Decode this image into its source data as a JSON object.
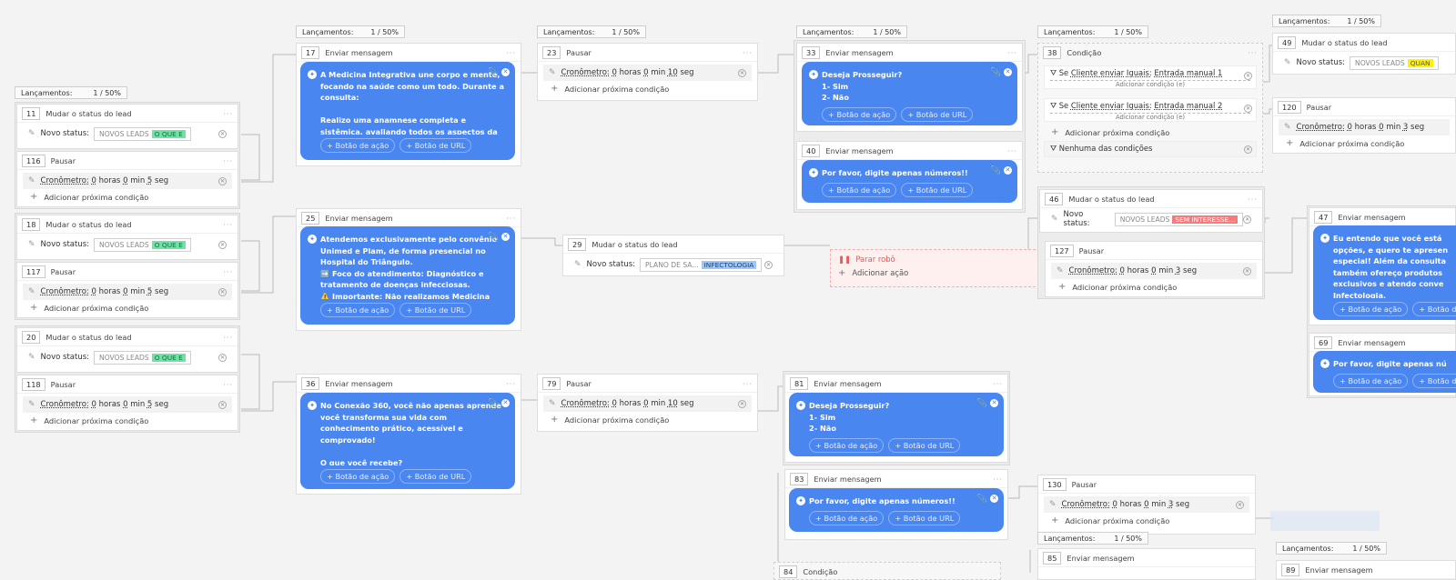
{
  "groups": {
    "g1": {
      "lancamentos": "Lançamentos:",
      "count": "1 / 50%"
    },
    "g2": {
      "lancamentos": "Lançamentos:",
      "count": "1 / 50%"
    },
    "g3": {
      "lancamentos": "Lançamentos:",
      "count": "1 / 50%"
    },
    "g4": {
      "lancamentos": "Lançamentos:",
      "count": "1 / 50%"
    },
    "g5": {
      "lancamentos": "Lançamentos:",
      "count": "1 / 50%"
    },
    "g6": {
      "lancamentos": "Lançamentos:",
      "count": "1 / 50%"
    },
    "g7": {
      "lancamentos": "Lançamentos:",
      "count": "1 / 50%"
    },
    "g8": {
      "lancamentos": "Lançamentos:",
      "count": "1 / 50%"
    }
  },
  "labels": {
    "mudar": "Mudar o status do lead",
    "pausar": "Pausar",
    "enviar": "Enviar mensagem",
    "condicao": "Condição",
    "novo_status": "Novo status:",
    "cron": "Cronômetro:",
    "horas": "horas",
    "min": "min",
    "seg": "seg",
    "add_cond": "Adicionar próxima condição",
    "add_acao": "Adicionar ação",
    "btn_acao": "+ Botão de ação",
    "btn_url": "+ Botão de URL",
    "parar": "Parar robô",
    "nenhuma": "Nenhuma das condições",
    "adicionar_condicao_e": "Adicionar condição (e)",
    "se": "Se",
    "cliente_enviar": "Cliente enviar",
    "iguais": "Iguais:",
    "novos_leads": "NOVOS LEADS",
    "plano": "PLANO DE SA..."
  },
  "nodes": {
    "n11": {
      "id": "11",
      "tag": "O QUE E"
    },
    "n116": {
      "id": "116",
      "h": "0",
      "m": "0",
      "s": "5"
    },
    "n18": {
      "id": "18",
      "tag": "O QUE E"
    },
    "n117": {
      "id": "117",
      "h": "0",
      "m": "0",
      "s": "5"
    },
    "n20": {
      "id": "20",
      "tag": "O QUE E"
    },
    "n118": {
      "id": "118",
      "h": "0",
      "m": "0",
      "s": "5"
    },
    "n17": {
      "id": "17",
      "msg": "A Medicina Integrativa une corpo e mente, focando na saúde como um todo. Durante a consulta:\n\nRealizo uma anamnese completa e sistêmica, avaliando todos os aspectos da"
    },
    "n25": {
      "id": "25",
      "msg": "Atendemos exclusivamente pelo convênio Unimed e Plam, de forma presencial no Hospital do Triângulo.\n➡️ Foco do atendimento: Diagnóstico e tratamento de doenças infecciosas.\n⚠️ Importante: Não realizamos Medicina"
    },
    "n36": {
      "id": "36",
      "msg": "No Conexão 360, você não apenas aprende – você transforma sua vida com conhecimento prático, acessível e comprovado!\n\nO que você recebe?"
    },
    "n23": {
      "id": "23",
      "h": "0",
      "m": "0",
      "s": "10"
    },
    "n29": {
      "id": "29",
      "tag": "INFECTOLOGIA"
    },
    "n79": {
      "id": "79",
      "h": "0",
      "m": "0",
      "s": "10"
    },
    "n33": {
      "id": "33",
      "msg": "Deseja Prosseguir?\n1- Sim\n2- Não"
    },
    "n40": {
      "id": "40",
      "msg": "Por favor, digite apenas números!!"
    },
    "n81": {
      "id": "81",
      "msg": "Deseja Prosseguir?\n1- Sim\n2- Não"
    },
    "n83": {
      "id": "83",
      "msg": "Por favor, digite apenas números!!"
    },
    "n84": {
      "id": "84"
    },
    "n38": {
      "id": "38",
      "c1": "Entrada manual 1",
      "c2": "Entrada manual 2"
    },
    "n46": {
      "id": "46",
      "tag": "SEM INTERESSE..."
    },
    "n127": {
      "id": "127",
      "h": "0",
      "m": "0",
      "s": "3"
    },
    "n130": {
      "id": "130",
      "h": "0",
      "m": "0",
      "s": "3"
    },
    "n85": {
      "id": "85"
    },
    "n49": {
      "id": "49",
      "tag": "QUAN"
    },
    "n120": {
      "id": "120",
      "h": "0",
      "m": "0",
      "s": "3"
    },
    "n47": {
      "id": "47",
      "msg": "Eu entendo que você está opções, e quero te apresen especial! Além da consulta também ofereço produtos exclusivos e atendo conve Infectologia."
    },
    "n69": {
      "id": "69",
      "msg": "Por favor, digite apenas nú"
    },
    "n89": {
      "id": "89"
    }
  },
  "colors": {
    "bubble": "#4a86f0",
    "green_tag": "#6ee3a5",
    "red_tag": "#f47c7c",
    "blue_tag": "#9cc6ff",
    "yellow_tag": "#fff100"
  }
}
